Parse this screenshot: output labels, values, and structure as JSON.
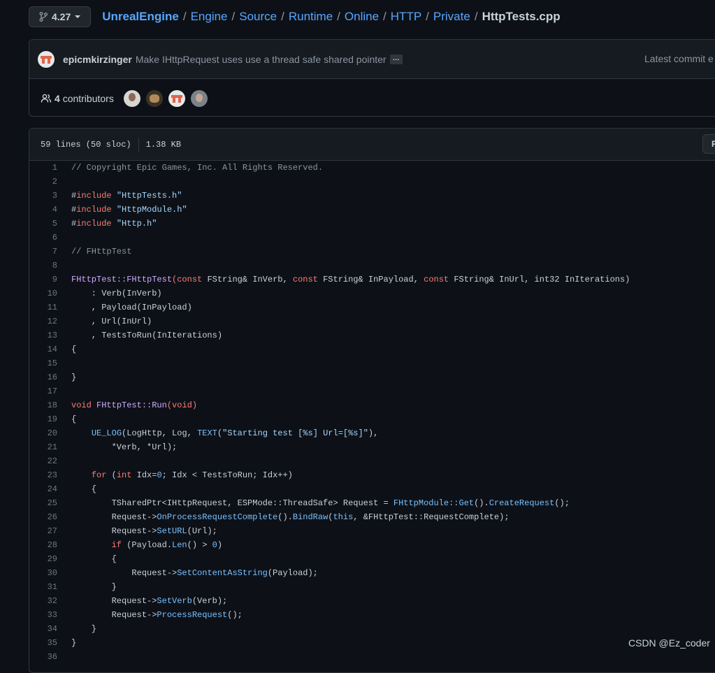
{
  "branch": {
    "label": "4.27",
    "icon": "git-branch-icon",
    "caret": "caret-down-icon"
  },
  "breadcrumb": {
    "repo": "UnrealEngine",
    "parts": [
      "Engine",
      "Source",
      "Runtime",
      "Online",
      "HTTP",
      "Private"
    ],
    "separator": "/",
    "file": "HttpTests.cpp"
  },
  "commit": {
    "author": "epicmkirzinger",
    "message": "Make IHttpRequest uses use a thread safe shared pointer",
    "ellipsis": "…",
    "latest": "Latest commit e"
  },
  "contributors": {
    "count": "4",
    "label": "contributors",
    "icon": "people-icon"
  },
  "file": {
    "lines_info": "59 lines (50 sloc)",
    "size": "1.38 KB",
    "raw_button": "Raw"
  },
  "colors": {
    "background": "#0d1117",
    "link": "#58a6ff",
    "comment": "#8b949e",
    "keyword": "#ff7b72",
    "string": "#a5d6ff",
    "function": "#d2a8ff",
    "constant": "#79c0ff"
  },
  "code": {
    "line_numbers": [
      "1",
      "2",
      "3",
      "4",
      "5",
      "6",
      "7",
      "8",
      "9",
      "10",
      "11",
      "12",
      "13",
      "14",
      "15",
      "16",
      "17",
      "18",
      "19",
      "20",
      "21",
      "22",
      "23",
      "24",
      "25",
      "26",
      "27",
      "28",
      "29",
      "30",
      "31",
      "32",
      "33",
      "34",
      "35",
      "36"
    ],
    "l1": [
      "// Copyright Epic Games, Inc. All Rights Reserved."
    ],
    "l3": [
      "#",
      "include",
      " ",
      "\"HttpTests.h\""
    ],
    "l4": [
      "#",
      "include",
      " ",
      "\"HttpModule.h\""
    ],
    "l5": [
      "#",
      "include",
      " ",
      "\"Http.h\""
    ],
    "l7": [
      "// FHttpTest"
    ],
    "l9": [
      "FHttpTest::FHttpTest",
      "(",
      "const",
      " FString& InVerb, ",
      "const",
      " FString& InPayload, ",
      "const",
      " FString& InUrl, int32 InIterations)"
    ],
    "l10": [
      "    : Verb(InVerb)"
    ],
    "l11": [
      "    , Payload(InPayload)"
    ],
    "l12": [
      "    , Url(InUrl)"
    ],
    "l13": [
      "    , TestsToRun(InIterations)"
    ],
    "l14": [
      "{"
    ],
    "l16": [
      "}"
    ],
    "l18": [
      "void",
      " ",
      "FHttpTest::Run",
      "(",
      "void",
      ")"
    ],
    "l19": [
      "{"
    ],
    "l20": [
      "    ",
      "UE_LOG",
      "(LogHttp, Log, ",
      "TEXT",
      "(",
      "\"Starting test [%s] Url=[%s]\"",
      "),"
    ],
    "l21": [
      "        *Verb, *Url);"
    ],
    "l23": [
      "    ",
      "for",
      " (",
      "int",
      " Idx=",
      "0",
      "; Idx < TestsToRun; Idx++)"
    ],
    "l24": [
      "    {"
    ],
    "l25": [
      "        TSharedPtr<IHttpRequest, ESPMode::ThreadSafe> Request = ",
      "FHttpModule::Get",
      "().",
      "CreateRequest",
      "();"
    ],
    "l26": [
      "        Request->",
      "OnProcessRequestComplete",
      "().",
      "BindRaw",
      "(",
      "this",
      ", &FHttpTest::RequestComplete);"
    ],
    "l27": [
      "        Request->",
      "SetURL",
      "(Url);"
    ],
    "l28": [
      "        ",
      "if",
      " (Payload.",
      "Len",
      "() > ",
      "0",
      ")"
    ],
    "l29": [
      "        {"
    ],
    "l30": [
      "            Request->",
      "SetContentAsString",
      "(Payload);"
    ],
    "l31": [
      "        }"
    ],
    "l32": [
      "        Request->",
      "SetVerb",
      "(Verb);"
    ],
    "l33": [
      "        Request->",
      "ProcessRequest",
      "();"
    ],
    "l34": [
      "    }"
    ],
    "l35": [
      "}"
    ]
  },
  "watermark": "CSDN @Ez_coder"
}
